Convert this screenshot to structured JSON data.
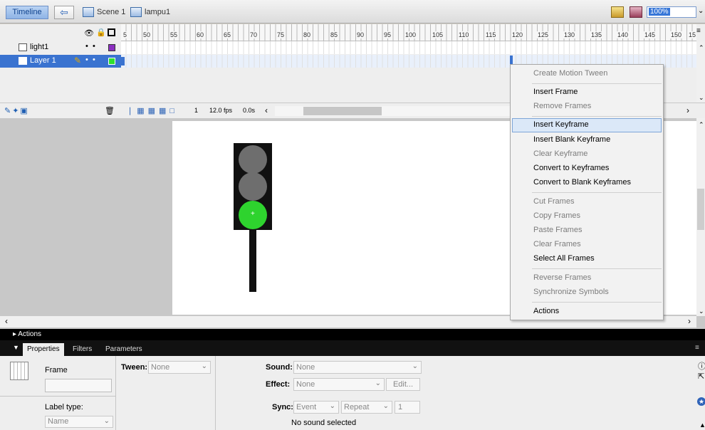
{
  "topbar": {
    "timeline_button": "Timeline",
    "back_icon": "back-arrow-icon",
    "scene_label": "Scene 1",
    "symbol_label": "lampu1",
    "zoom_value": "100%"
  },
  "timeline": {
    "ruler_labels": [
      "5",
      "50",
      "55",
      "60",
      "65",
      "70",
      "75",
      "80",
      "85",
      "90",
      "95",
      "100",
      "105",
      "110",
      "115",
      "120",
      "125",
      "130",
      "135",
      "140",
      "145",
      "150",
      "15"
    ],
    "layers": [
      {
        "name": "light1",
        "color": "#8b2fc0",
        "selected": false
      },
      {
        "name": "Layer 1",
        "color": "#2ee02e",
        "selected": true
      }
    ],
    "footer": {
      "current_frame": "1",
      "fps": "12.0 fps",
      "elapsed": "0.0s"
    }
  },
  "stage": {
    "lamp_colors": {
      "red_lamp": "#6e6e6e",
      "yellow_lamp": "#6e6e6e",
      "green_lamp": "#2ed32e"
    }
  },
  "context_menu": {
    "items": [
      {
        "label": "Create Motion Tween",
        "enabled": false
      },
      {
        "label": "Insert Frame",
        "enabled": true
      },
      {
        "label": "Remove Frames",
        "enabled": false
      },
      {
        "label": "Insert Keyframe",
        "enabled": true,
        "highlighted": true
      },
      {
        "label": "Insert Blank Keyframe",
        "enabled": true
      },
      {
        "label": "Clear Keyframe",
        "enabled": false
      },
      {
        "label": "Convert to Keyframes",
        "enabled": true
      },
      {
        "label": "Convert to Blank Keyframes",
        "enabled": true
      },
      {
        "label": "Cut Frames",
        "enabled": false
      },
      {
        "label": "Copy Frames",
        "enabled": false
      },
      {
        "label": "Paste Frames",
        "enabled": false
      },
      {
        "label": "Clear Frames",
        "enabled": false
      },
      {
        "label": "Select All Frames",
        "enabled": true
      },
      {
        "label": "Reverse Frames",
        "enabled": false
      },
      {
        "label": "Synchronize Symbols",
        "enabled": false
      },
      {
        "label": "Actions",
        "enabled": true
      }
    ]
  },
  "panels": {
    "actions_label": "Actions",
    "tabs": [
      "Properties",
      "Filters",
      "Parameters"
    ]
  },
  "properties": {
    "frame_label": "Frame",
    "label_type_label": "Label type:",
    "label_type_value": "Name",
    "tween_label": "Tween:",
    "tween_value": "None",
    "sound_label": "Sound:",
    "sound_value": "None",
    "effect_label": "Effect:",
    "effect_value": "None",
    "edit_button": "Edit...",
    "sync_label": "Sync:",
    "sync_value": "Event",
    "repeat_value": "Repeat",
    "repeat_count": "1",
    "no_sound_text": "No sound selected"
  }
}
